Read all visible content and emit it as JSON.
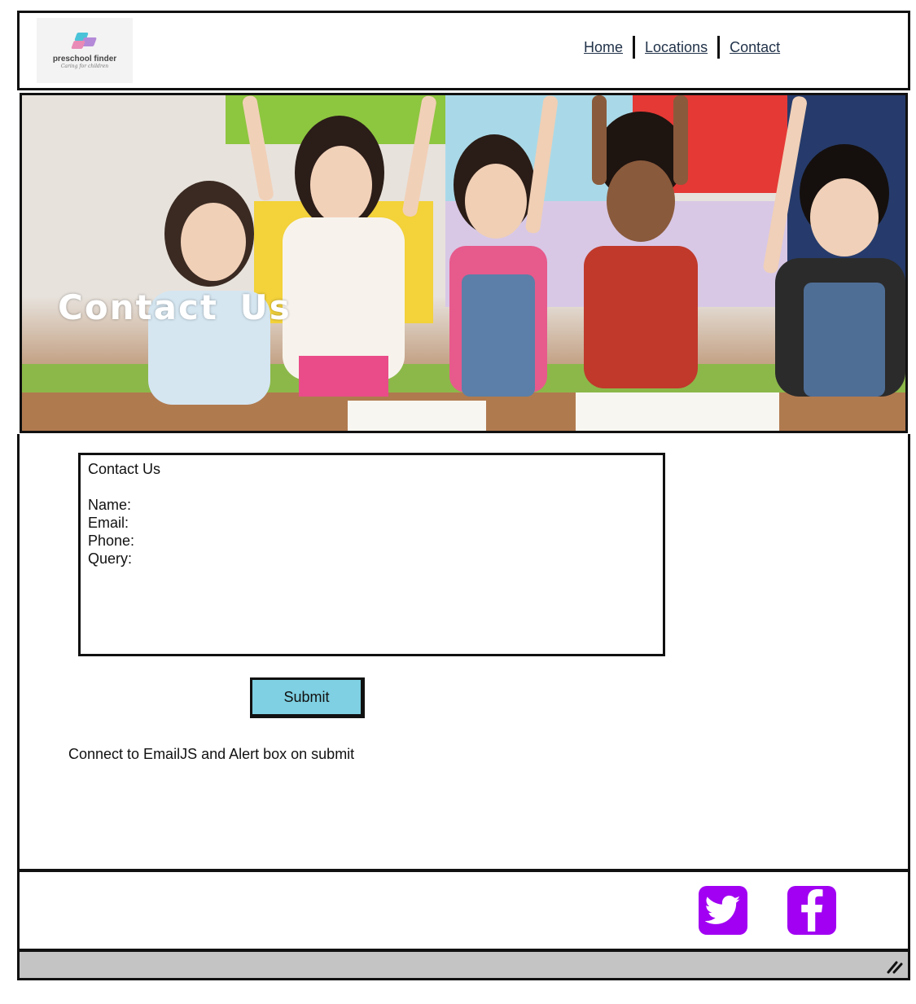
{
  "header": {
    "logo": {
      "name": "preschool finder",
      "tagline": "Caring for children"
    },
    "nav": [
      {
        "label": "Home"
      },
      {
        "label": "Locations"
      },
      {
        "label": "Contact"
      }
    ]
  },
  "hero": {
    "title": "Contact Us"
  },
  "form": {
    "title": "Contact Us",
    "fields": [
      {
        "label": "Name:"
      },
      {
        "label": "Email:"
      },
      {
        "label": "Phone:"
      },
      {
        "label": "Query:"
      }
    ],
    "submit_label": "Submit"
  },
  "note": "Connect to EmailJS and Alert box on submit",
  "footer": {
    "icons": [
      "twitter-icon",
      "facebook-icon"
    ],
    "icon_color": "#a100f2"
  },
  "colors": {
    "submit_bg": "#7ed0e2",
    "nav_text": "#22334a"
  }
}
